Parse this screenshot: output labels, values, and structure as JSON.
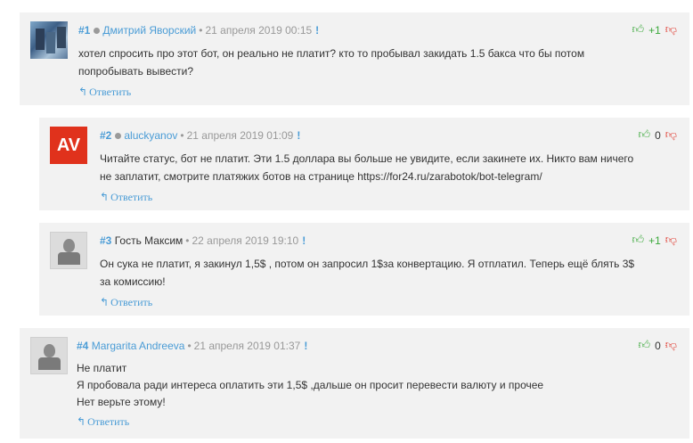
{
  "reply_label": "Ответить",
  "comments": [
    {
      "num": "#1",
      "author": "Дмитрий Яворский",
      "date": "21 апреля 2019 00:15",
      "text": "хотел спросить про этот бот, он реально не платит? кто то пробывал закидать 1.5 бакса что бы потом попробывать вывести?",
      "score": "+1"
    },
    {
      "num": "#2",
      "author": "aluckyanov",
      "avatar_initials": "AV",
      "date": "21 апреля 2019 01:09",
      "text": "Читайте статус, бот не платит. Эти 1.5 доллара вы больше не увидите, если закинете их. Никто вам ничего не заплатит, смотрите платяжих ботов на странице https://for24.ru/zarabotok/bot-telegram/",
      "score": "0"
    },
    {
      "num": "#3",
      "author": "Гость Максим",
      "date": "22 апреля 2019 19:10",
      "text": "Он сука не платит, я закинул 1,5$ , потом он запросил 1$за конвертацию. Я отплатил. Теперь ещё блять 3$ за комиссию!",
      "score": "+1"
    },
    {
      "num": "#4",
      "author": "Margarita Andreeva",
      "date": "21 апреля 2019 01:37",
      "text_lines": [
        "Не платит",
        "Я пробовала ради интереса оплатить эти 1,5$ ,дальше он просит перевести валюту и прочее",
        "Нет верьте этому!"
      ],
      "score": "0"
    }
  ],
  "colors": {
    "link": "#4a9cd6",
    "panel": "#f2f2f2",
    "upvote": "#3aa83a",
    "downvote": "#e03a2f",
    "avatar_av": "#e0321c"
  }
}
